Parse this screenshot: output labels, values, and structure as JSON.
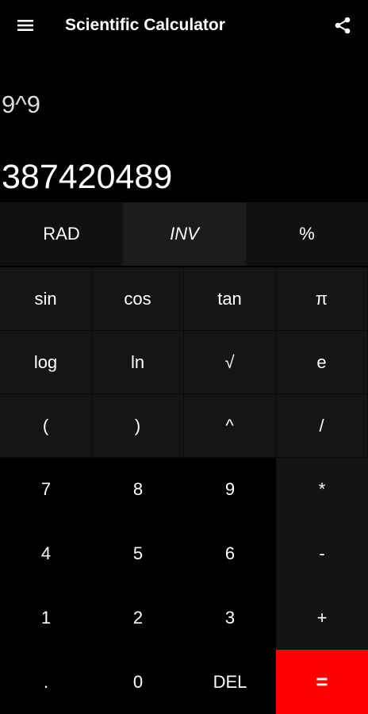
{
  "header": {
    "title": "Scientific Calculator",
    "menu_icon": "hamburger-menu-icon",
    "share_icon": "share-icon"
  },
  "display": {
    "expression": "9^9",
    "result": "387420489"
  },
  "mode_row": [
    {
      "label": "RAD"
    },
    {
      "label": "INV"
    },
    {
      "label": "%"
    }
  ],
  "keys": [
    {
      "label": "sin"
    },
    {
      "label": "cos"
    },
    {
      "label": "tan"
    },
    {
      "label": "π"
    },
    {
      "label": "log"
    },
    {
      "label": "ln"
    },
    {
      "label": "√"
    },
    {
      "label": "e"
    },
    {
      "label": "("
    },
    {
      "label": ")"
    },
    {
      "label": "^"
    },
    {
      "label": "/"
    },
    {
      "label": "7"
    },
    {
      "label": "8"
    },
    {
      "label": "9"
    },
    {
      "label": "*"
    },
    {
      "label": "4"
    },
    {
      "label": "5"
    },
    {
      "label": "6"
    },
    {
      "label": "-"
    },
    {
      "label": "1"
    },
    {
      "label": "2"
    },
    {
      "label": "3"
    },
    {
      "label": "+"
    },
    {
      "label": "."
    },
    {
      "label": "0"
    },
    {
      "label": "DEL"
    },
    {
      "label": "="
    }
  ],
  "colors": {
    "background": "#000000",
    "scientific_key": "#151515",
    "operator_key": "#141414",
    "equals_key": "#ff0000",
    "text": "#ffffff"
  }
}
